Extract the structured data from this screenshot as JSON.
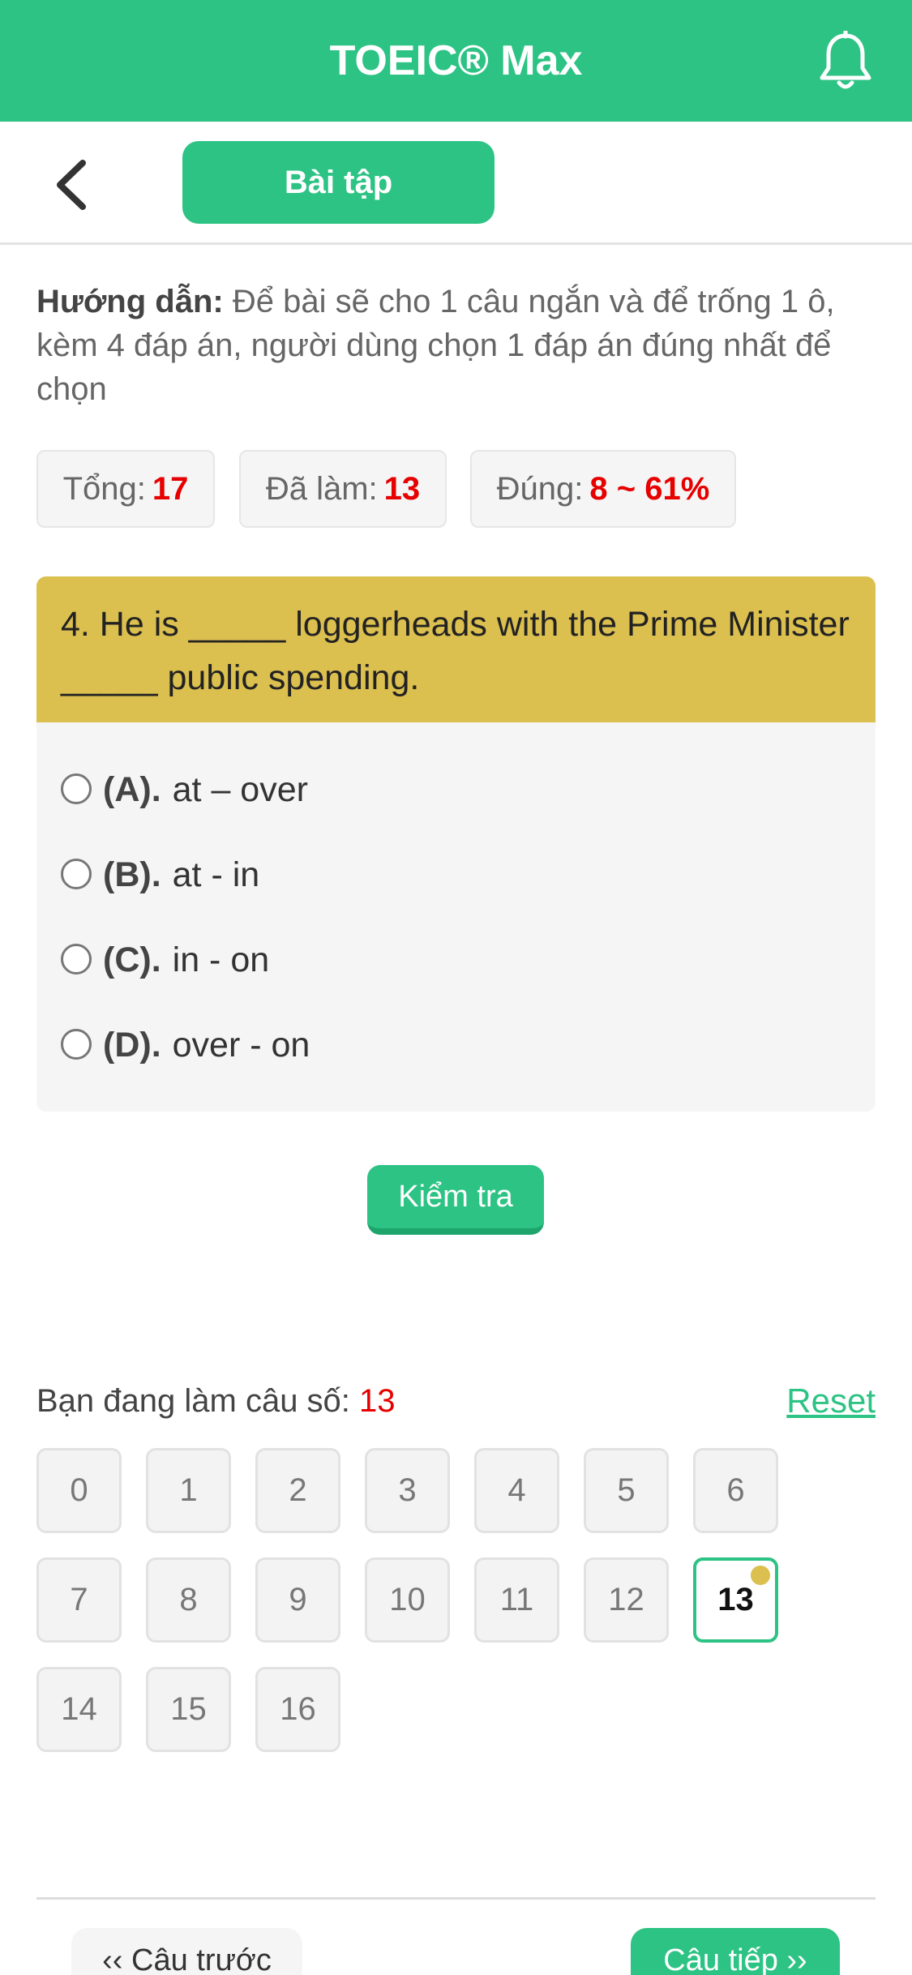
{
  "header": {
    "title": "TOEIC® Max",
    "bell_icon": "bell-icon",
    "back_icon": "chevron-left-icon",
    "tab_label": "Bài tập"
  },
  "instructions": {
    "label": "Hướng dẫn:",
    "text": "Để bài sẽ cho 1 câu ngắn và để trống 1 ô, kèm 4 đáp án, người dùng chọn 1 đáp án đúng nhất để chọn"
  },
  "stats": {
    "total_label": "Tổng:",
    "total_value": "17",
    "done_label": "Đã làm:",
    "done_value": "13",
    "correct_label": "Đúng:",
    "correct_value": "8 ~ 61%"
  },
  "question": {
    "text": "4. He is _____ loggerheads with the Prime Minister _____ public spending.",
    "options": [
      {
        "key": "(A).",
        "text": "at – over"
      },
      {
        "key": "(B).",
        "text": "at - in"
      },
      {
        "key": "(C).",
        "text": "in - on"
      },
      {
        "key": "(D).",
        "text": "over - on"
      }
    ]
  },
  "check_button": "Kiểm tra",
  "progress": {
    "label": "Bạn đang làm câu số:",
    "current": "13",
    "reset_label": "Reset",
    "numbers": [
      "0",
      "1",
      "2",
      "3",
      "4",
      "5",
      "6",
      "7",
      "8",
      "9",
      "10",
      "11",
      "12",
      "13",
      "14",
      "15",
      "16"
    ],
    "active_index": 13
  },
  "nav": {
    "prev_label": "‹‹ Câu trước",
    "next_label": "Câu tiếp ››"
  },
  "colors": {
    "brand_green": "#2dc384",
    "question_header": "#dbbf4f",
    "value_red": "#e60000"
  }
}
